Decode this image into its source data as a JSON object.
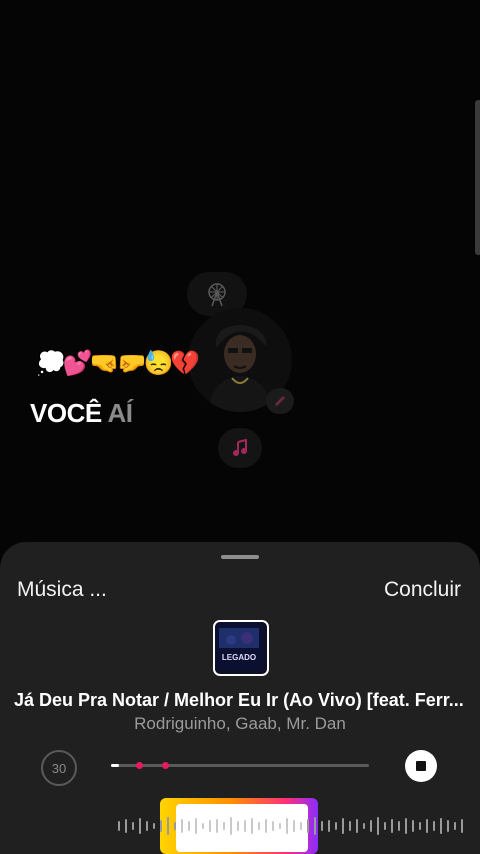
{
  "story": {
    "emoji_text": "💭💕🤜🤛😓💔",
    "caption_main": "VOCÊ",
    "caption_dim": "AÍ"
  },
  "music_sheet": {
    "header_left": "Música ...",
    "header_right": "Concluir",
    "album_art_label": "LEGADO",
    "song_title": "Já Deu Pra Notar / Melhor Eu Ir (Ao Vivo) [feat. Ferr...",
    "song_artist": "Rodriguinho, Gaab, Mr. Dan",
    "duration_label": "30",
    "progress": 0.02
  },
  "colors": {
    "sheet_bg": "#202020",
    "accent_marker": "#e8195e",
    "selection_gradient": [
      "#ffd400",
      "#ff8f00",
      "#ff2f7a",
      "#8a2cff"
    ]
  }
}
